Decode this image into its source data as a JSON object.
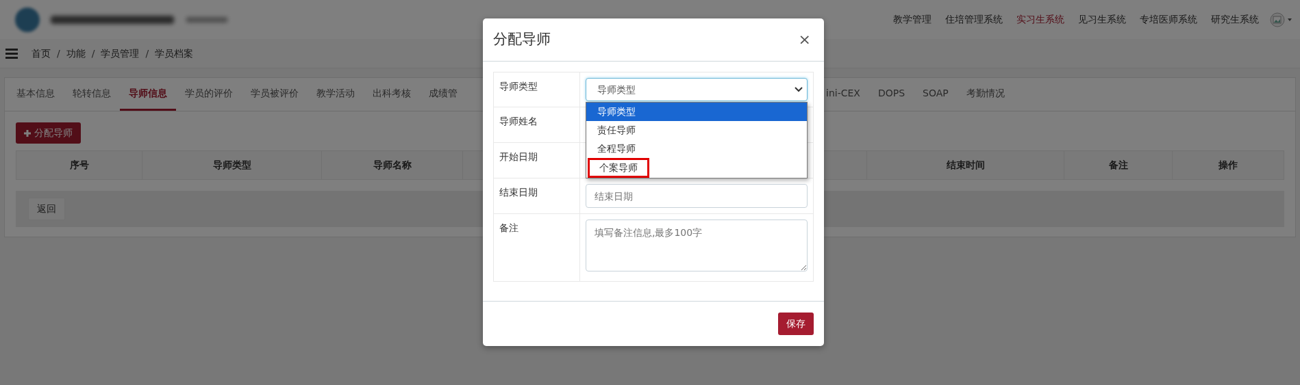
{
  "header": {
    "nav_items": [
      {
        "label": "教学管理",
        "selected": false
      },
      {
        "label": "住培管理系统",
        "selected": false
      },
      {
        "label": "实习生系统",
        "selected": true
      },
      {
        "label": "见习生系统",
        "selected": false
      },
      {
        "label": "专培医师系统",
        "selected": false
      },
      {
        "label": "研究生系统",
        "selected": false
      }
    ]
  },
  "breadcrumb": [
    {
      "label": "首页",
      "separator": "/"
    },
    {
      "label": "功能",
      "separator": "/"
    },
    {
      "label": "学员管理",
      "separator": "/"
    },
    {
      "label": "学员档案"
    }
  ],
  "tabs_left": [
    {
      "label": "基本信息",
      "selected": false
    },
    {
      "label": "轮转信息",
      "selected": false
    },
    {
      "label": "导师信息",
      "selected": true
    },
    {
      "label": "学员的评价",
      "selected": false
    },
    {
      "label": "学员被评价",
      "selected": false
    },
    {
      "label": "教学活动",
      "selected": false
    },
    {
      "label": "出科考核",
      "selected": false
    },
    {
      "label": "成绩管",
      "selected": false
    }
  ],
  "tabs_right": [
    {
      "label": "ini-CEX",
      "selected": false
    },
    {
      "label": "DOPS",
      "selected": false
    },
    {
      "label": "SOAP",
      "selected": false
    },
    {
      "label": "考勤情况",
      "selected": false
    }
  ],
  "assign_button": "分配导师",
  "table": {
    "columns_left": [
      "序号",
      "导师类型",
      "导师名称"
    ],
    "columns_right": [
      "结束时间",
      "备注",
      "操作"
    ]
  },
  "back_button": "返回",
  "modal": {
    "title": "分配导师",
    "close": "×",
    "fields": [
      {
        "label": "导师类型",
        "kind": "select",
        "value": "导师类型",
        "options": [
          {
            "label": "导师类型",
            "selected": true,
            "highlighted": false
          },
          {
            "label": "责任导师",
            "selected": false,
            "highlighted": false
          },
          {
            "label": "全程导师",
            "selected": false,
            "highlighted": false
          },
          {
            "label": "个案导师",
            "selected": false,
            "highlighted": true
          }
        ]
      },
      {
        "label": "导师姓名",
        "kind": "covered"
      },
      {
        "label": "开始日期",
        "kind": "covered"
      },
      {
        "label": "结束日期",
        "kind": "input",
        "placeholder": "结束日期"
      },
      {
        "label": "备注",
        "kind": "textarea",
        "placeholder": "填写备注信息,最多100字"
      }
    ],
    "save_button": "保存"
  }
}
